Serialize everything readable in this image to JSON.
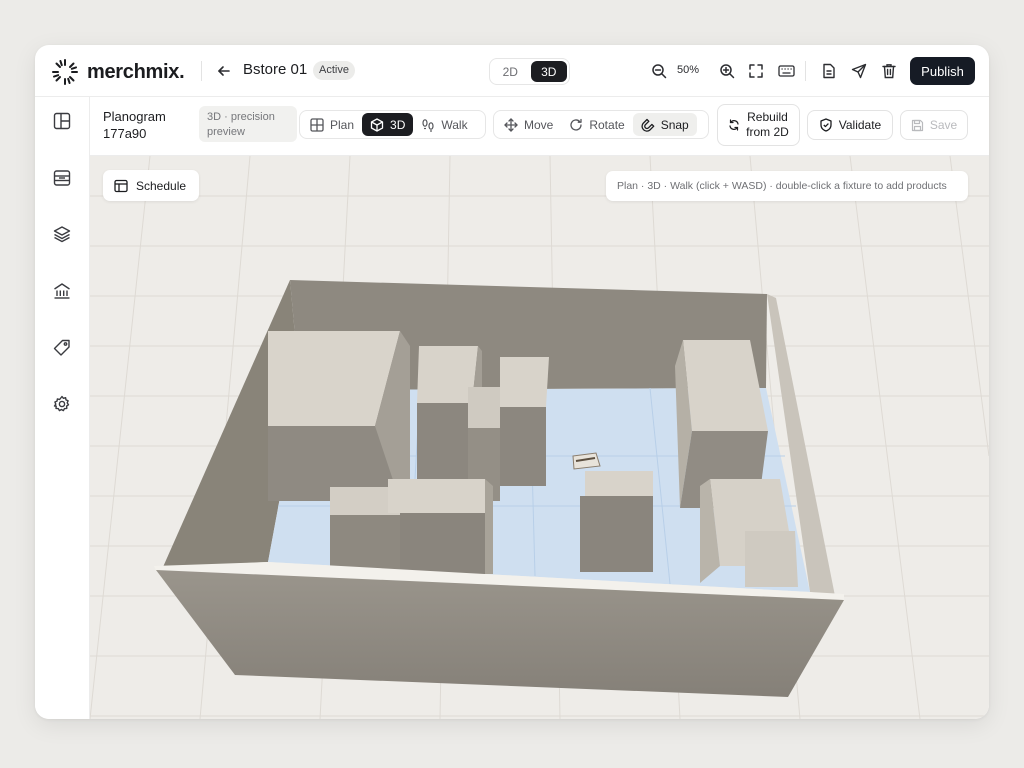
{
  "app": {
    "name": "merchmix."
  },
  "header": {
    "store_name": "Bstore 01",
    "status_badge": "Active",
    "view_modes": [
      "2D",
      "3D"
    ],
    "active_view_mode": "3D",
    "zoom_level": "50%",
    "publish_label": "Publish"
  },
  "toolbar": {
    "planogram_title": "Planogram",
    "planogram_id": "177a90",
    "precision_line1": "3D · precision",
    "precision_line2": "preview",
    "view_tools": {
      "plan": "Plan",
      "three_d": "3D",
      "walk": "Walk"
    },
    "edit_tools": {
      "move": "Move",
      "rotate": "Rotate",
      "snap": "Snap"
    },
    "rebuild_line1": "Rebuild",
    "rebuild_line2": "from 2D",
    "validate_label": "Validate",
    "save_label": "Save"
  },
  "canvas": {
    "schedule_label": "Schedule",
    "hint_text": "Plan · 3D · Walk (click + WASD) · double-click a fixture to add products"
  },
  "sidebar": {
    "items": [
      "layout-icon",
      "fixtures-icon",
      "layers-icon",
      "store-icon",
      "tag-icon",
      "settings-icon"
    ]
  },
  "colors": {
    "publish_bg": "#161b25",
    "wall": "#8f8a80",
    "floor_tile": "#c9dcef",
    "fixture": "#cdc7bd",
    "canvas_bg": "#eeece8"
  }
}
